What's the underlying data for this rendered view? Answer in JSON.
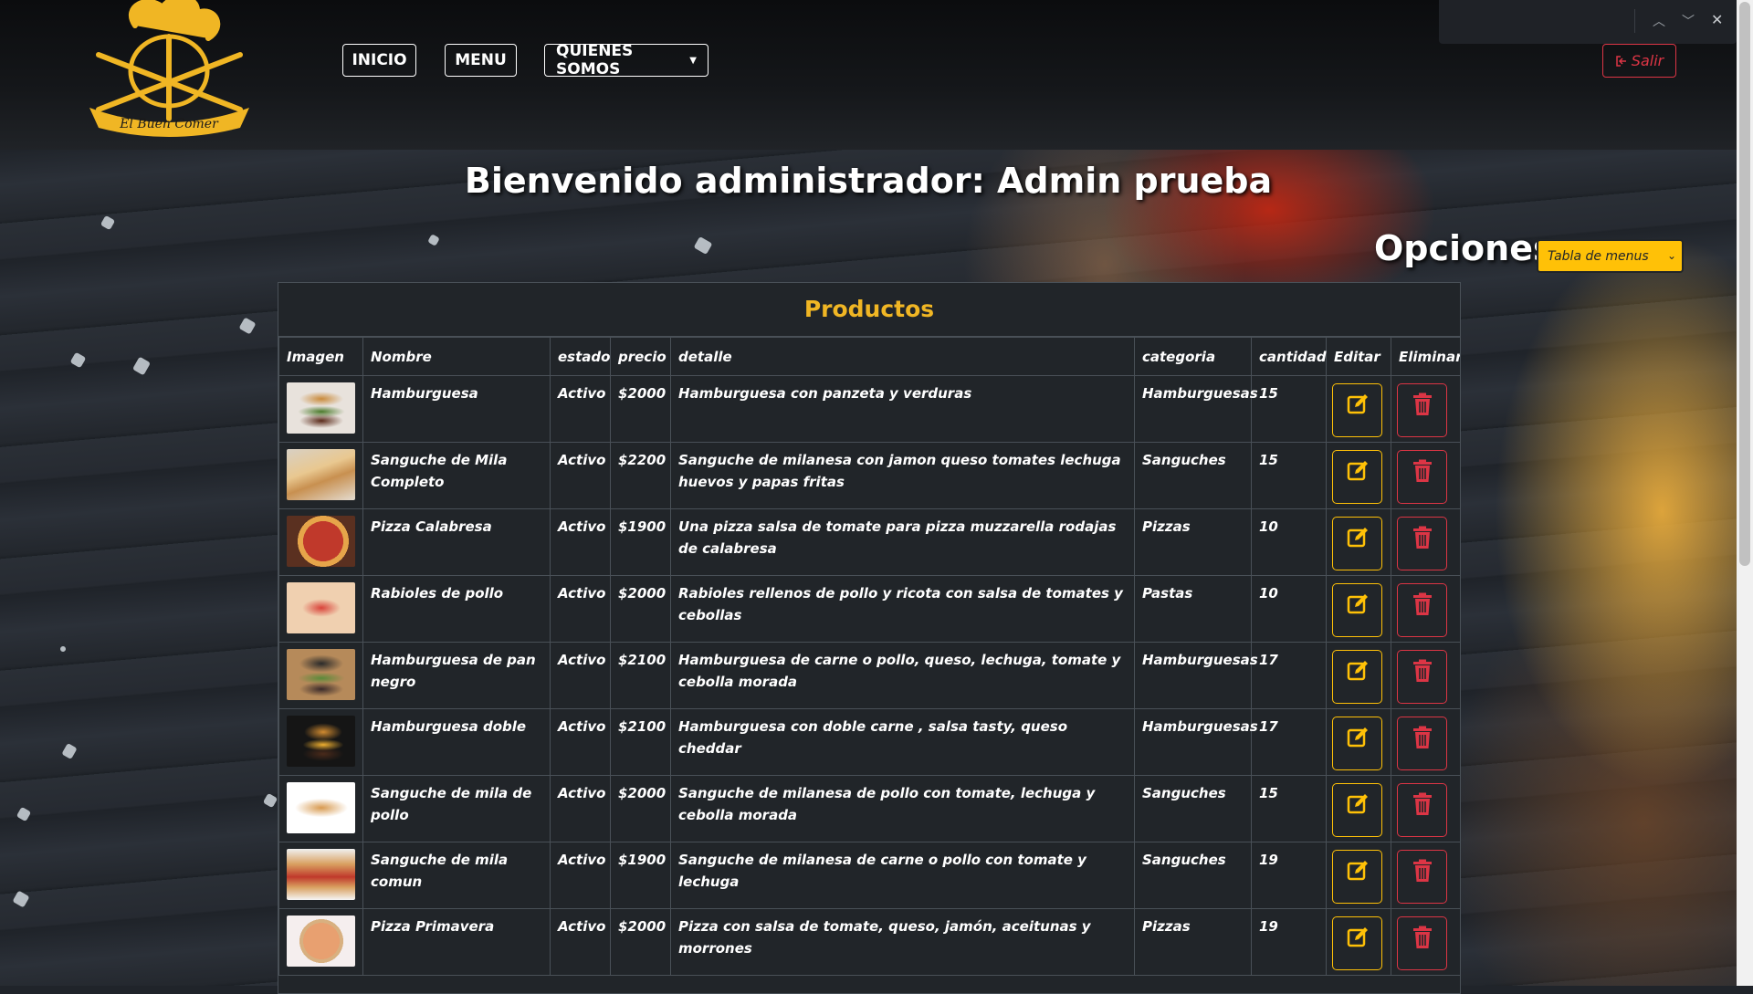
{
  "nav": {
    "logo_text": "El Buen Comer",
    "inicio": "INICIO",
    "menu": "MENU",
    "quienes": "QUIENES SOMOS",
    "salir": "Salir"
  },
  "welcome": "Bienvenido administrador: Admin prueba",
  "opciones": {
    "label": "Opciones",
    "selected": "Tabla de menus"
  },
  "table": {
    "caption": "Productos",
    "headers": [
      "Imagen",
      "Nombre",
      "estado",
      "precio",
      "detalle",
      "categoria",
      "cantidad",
      "Editar",
      "Eliminar"
    ],
    "rows": [
      {
        "nombre": "Hamburguesa",
        "estado": "Activo",
        "precio": "$2000",
        "detalle": "Hamburguesa con panzeta y verduras",
        "categoria": "Hamburguesas",
        "cantidad": "15",
        "img": "burger"
      },
      {
        "nombre": "Sanguche de Mila Completo",
        "estado": "Activo",
        "precio": "$2200",
        "detalle": "Sanguche de milanesa con jamon queso tomates lechuga huevos y papas fritas",
        "categoria": "Sanguches",
        "cantidad": "15",
        "img": "sandwich"
      },
      {
        "nombre": "Pizza Calabresa",
        "estado": "Activo",
        "precio": "$1900",
        "detalle": "Una pizza salsa de tomate para pizza muzzarella rodajas de calabresa",
        "categoria": "Pizzas",
        "cantidad": "10",
        "img": "pizza"
      },
      {
        "nombre": "Rabioles de pollo",
        "estado": "Activo",
        "precio": "$2000",
        "detalle": "Rabioles rellenos de pollo y ricota con salsa de tomates y cebollas",
        "categoria": "Pastas",
        "cantidad": "10",
        "img": "pasta"
      },
      {
        "nombre": "Hamburguesa de pan negro",
        "estado": "Activo",
        "precio": "$2100",
        "detalle": "Hamburguesa de carne o pollo, queso, lechuga, tomate y cebolla morada",
        "categoria": "Hamburguesas",
        "cantidad": "17",
        "img": "burger-dark"
      },
      {
        "nombre": "Hamburguesa doble",
        "estado": "Activo",
        "precio": "$2100",
        "detalle": "Hamburguesa con doble carne , salsa tasty, queso cheddar",
        "categoria": "Hamburguesas",
        "cantidad": "17",
        "img": "burger-double"
      },
      {
        "nombre": "Sanguche de mila de pollo",
        "estado": "Activo",
        "precio": "$2000",
        "detalle": "Sanguche de milanesa de pollo con tomate, lechuga y cebolla morada",
        "categoria": "Sanguches",
        "cantidad": "15",
        "img": "sandwich-light"
      },
      {
        "nombre": "Sanguche de mila comun",
        "estado": "Activo",
        "precio": "$1900",
        "detalle": "Sanguche de milanesa de carne o pollo con tomate y lechuga",
        "categoria": "Sanguches",
        "cantidad": "19",
        "img": "sandwich-sub"
      },
      {
        "nombre": "Pizza Primavera",
        "estado": "Activo",
        "precio": "$2000",
        "detalle": "Pizza con salsa de tomate, queso, jamón, aceitunas y morrones",
        "categoria": "Pizzas",
        "cantidad": "19",
        "img": "pizza-light"
      }
    ]
  },
  "colors": {
    "accent_yellow": "#ffc107",
    "danger_red": "#dc3545",
    "caption_gold": "#f0b624",
    "table_bg": "#212529"
  }
}
